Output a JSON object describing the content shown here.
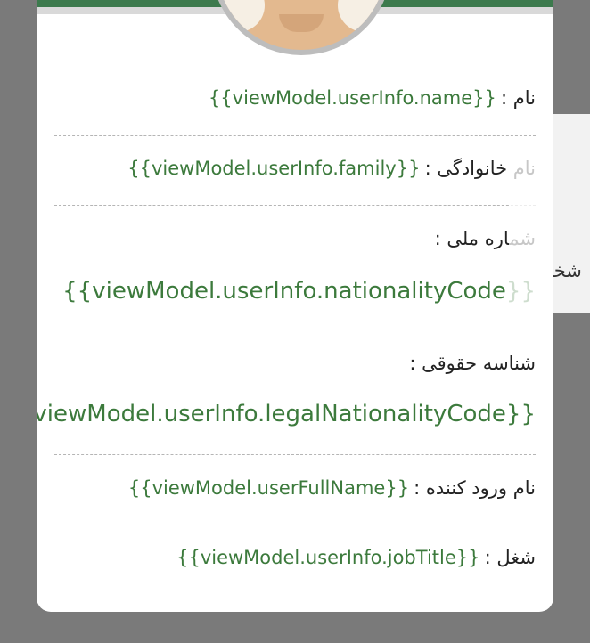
{
  "background_panel": {
    "text": "شخص"
  },
  "profile": {
    "fields": [
      {
        "label": "نام :",
        "value": "{{viewModel.userInfo.name}}"
      },
      {
        "label": "نام خانوادگی :",
        "value": "{{viewModel.userInfo.family}}"
      },
      {
        "label": "شماره ملی :",
        "value": "{{viewModel.userInfo.nationalityCode}}"
      },
      {
        "label": "شناسه حقوقی :",
        "value": "{{viewModel.userInfo.legalNationalityCode}}"
      },
      {
        "label": "نام ورود کننده :",
        "value": "{{viewModel.userFullName}}"
      },
      {
        "label": "شغل :",
        "value": "{{viewModel.userInfo.jobTitle}}"
      }
    ]
  },
  "colors": {
    "accent": "#3c7a4d",
    "value_text": "#3c7a3c",
    "overlay": "#7a7a7a"
  }
}
